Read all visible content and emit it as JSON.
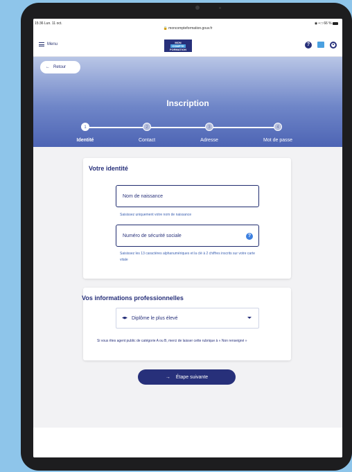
{
  "status_bar": {
    "time": "15:36  Lun. 11 oct.",
    "url": "moncompteformation.gouv.fr",
    "indicators": "◉ • □ 66 %"
  },
  "nav": {
    "menu_label": "Menu",
    "logo_line1": "MON",
    "logo_line2": "COMPTE",
    "logo_line3": "FORMATION",
    "help_glyph": "?"
  },
  "hero": {
    "back_label": "Retour",
    "title": "Inscription",
    "steps": [
      {
        "number": "1",
        "label": "Identité",
        "active": true
      },
      {
        "number": "2",
        "label": "Contact",
        "active": false
      },
      {
        "number": "3",
        "label": "Adresse",
        "active": false
      },
      {
        "number": "4",
        "label": "Mot de passe",
        "active": false
      }
    ]
  },
  "identity": {
    "title": "Votre identité",
    "birth_name_placeholder": "Nom de naissance",
    "birth_name_hint": "Saisissez uniquement votre nom de naissance",
    "ssn_placeholder": "Numéro de sécurité sociale",
    "ssn_help_glyph": "?",
    "ssn_hint": "Saisissez les 13 caractères alphanumériques et la clé à 2 chiffres inscrits sur votre carte vitale"
  },
  "professional": {
    "title": "Vos informations professionnelles",
    "diploma_select": "Diplôme le plus élevé",
    "diploma_hint": "Si vous êtes agent public de catégorie A ou B, merci de laisser cette rubrique à « Non renseigné »"
  },
  "next_button": "Étape suivante",
  "colors": {
    "brand_navy": "#27307a",
    "accent_blue": "#4aa0e0",
    "hero_gradient_end": "#4d64b4",
    "page_background": "#8ec5ea"
  }
}
